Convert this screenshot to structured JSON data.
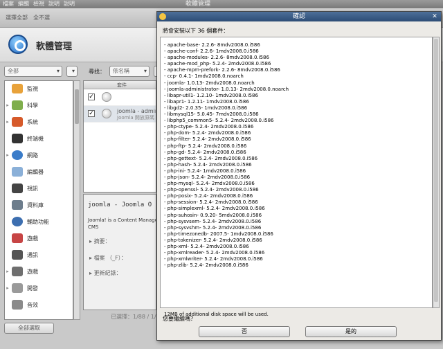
{
  "main_window": {
    "title": "軟體管理",
    "menu": [
      "檔案",
      "編輯",
      "檢視",
      "說明",
      "說明"
    ],
    "toolbar": [
      "選擇全部",
      "全不選"
    ],
    "app_title": "軟體管理",
    "filter": {
      "group_value": "全部",
      "search_label": "尋找：",
      "search_scope": "依名稱",
      "search_value": "jo"
    },
    "categories": [
      {
        "label": "監視"
      },
      {
        "label": "科學"
      },
      {
        "label": "系統"
      },
      {
        "label": "終端機"
      },
      {
        "label": "網路"
      },
      {
        "label": "編輯器"
      },
      {
        "label": "視訊"
      },
      {
        "label": "資料庫"
      },
      {
        "label": "輔助功能"
      },
      {
        "label": "遊戲"
      },
      {
        "label": "通訊"
      },
      {
        "label": "遊戲"
      },
      {
        "label": "開發"
      },
      {
        "label": "音效"
      }
    ],
    "package_list": {
      "column_header": "套件",
      "rows": [
        {
          "name": "",
          "summary": ""
        },
        {
          "name": "joomla - admin",
          "summary": "Joomla 開放原碼"
        }
      ]
    },
    "details": {
      "title": "joomla - Joomla O",
      "description": "Joomla! is a Content Manage that brought the Mambo CMS",
      "links": [
        "摘要：",
        "檔案 （_F）：",
        "更新紀錄："
      ]
    },
    "status": "已選擇：1/88 / 1/0",
    "select_all_button": "全部選取"
  },
  "dialog": {
    "title": "確認",
    "prompt": "將會安裝以下 36 個套件：",
    "packages": [
      "- apache-base- 2.2.6- 8mdv2008.0.i586",
      "- apache-conf- 2.2.6- 1mdv2008.0.i586",
      "- apache-modules- 2.2.6- 8mdv2008.0.i586",
      "- apache-mod_php- 5.2.4- 2mdv2008.0.i586",
      "- apache-mpm-prefork- 2.2.6- 8mdv2008.0.i586",
      "- ccp- 0.4.1- 1mdv2008.0.noarch",
      "- joomla- 1.0.13- 2mdv2008.0.noarch",
      "- joomla-administrator- 1.0.13- 2mdv2008.0.noarch",
      "- libapr-util1- 1.2.10- 1mdv2008.0.i586",
      "- libapr1- 1.2.11- 1mdv2008.0.i586",
      "- libgd2- 2.0.35- 1mdv2008.0.i586",
      "- libmysql15- 5.0.45- 7mdv2008.0.i586",
      "- libphp5_common5- 5.2.4- 2mdv2008.0.i586",
      "- php-ctype- 5.2.4- 2mdv2008.0.i586",
      "- php-dom- 5.2.4- 2mdv2008.0.i586",
      "- php-filter- 5.2.4- 2mdv2008.0.i586",
      "- php-ftp- 5.2.4- 2mdv2008.0.i586",
      "- php-gd- 5.2.4- 2mdv2008.0.i586",
      "- php-gettext- 5.2.4- 2mdv2008.0.i586",
      "- php-hash- 5.2.4- 2mdv2008.0.i586",
      "- php-ini- 5.2.4- 1mdv2008.0.i586",
      "- php-json- 5.2.4- 2mdv2008.0.i586",
      "- php-mysql- 5.2.4- 2mdv2008.0.i586",
      "- php-openssl- 5.2.4- 2mdv2008.0.i586",
      "- php-posix- 5.2.4- 2mdv2008.0.i586",
      "- php-session- 5.2.4- 2mdv2008.0.i586",
      "- php-simplexml- 5.2.4- 2mdv2008.0.i586",
      "- php-suhosin- 0.9.20- 5mdv2008.0.i586",
      "- php-sysvsem- 5.2.4- 2mdv2008.0.i586",
      "- php-sysvshm- 5.2.4- 2mdv2008.0.i586",
      "- php-timezonedb- 2007.5- 1mdv2008.0.i586",
      "- php-tokenizer- 5.2.4- 2mdv2008.0.i586",
      "- php-xml- 5.2.4- 2mdv2008.0.i586",
      "- php-xmlreader- 5.2.4- 2mdv2008.0.i586",
      "- php-xmlwriter- 5.2.4- 2mdv2008.0.i586",
      "- php-zlib- 5.2.4- 2mdv2008.0.i586"
    ],
    "disk_space": "12MB of additional disk space will be used.",
    "continue_prompt": "您要繼續嗎？",
    "no_label": "否",
    "yes_label": "是的"
  }
}
